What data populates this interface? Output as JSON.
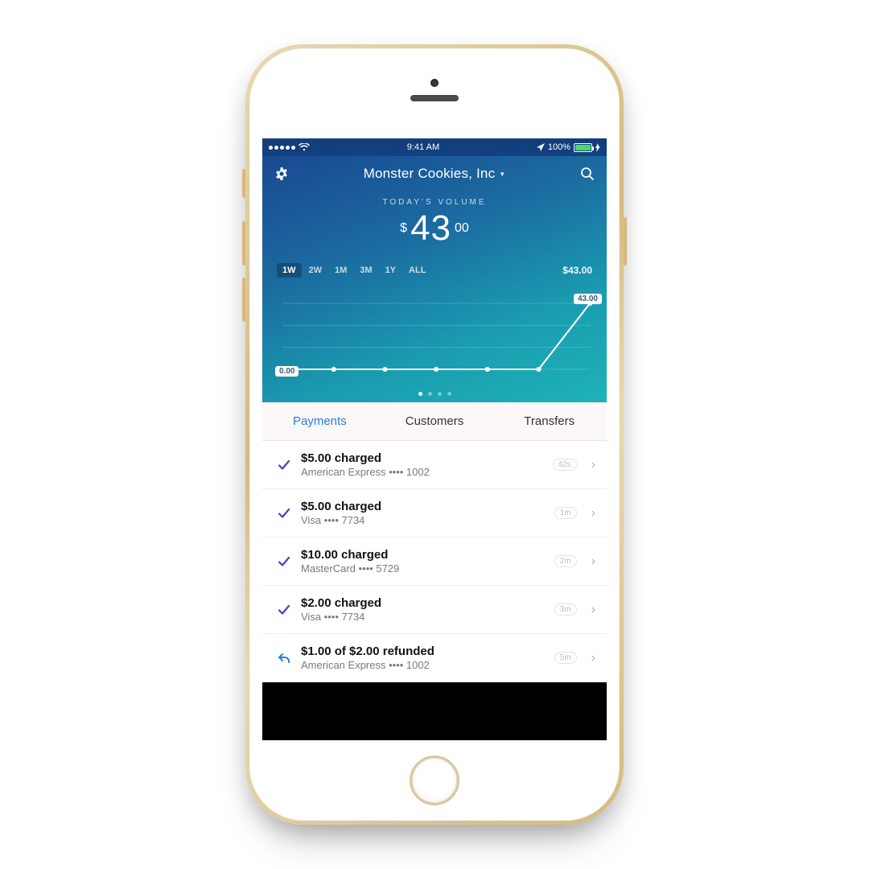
{
  "status": {
    "time": "9:41 AM",
    "battery_pct": "100%"
  },
  "header": {
    "account_name": "Monster Cookies, Inc",
    "volume_label": "TODAY'S VOLUME",
    "currency": "$",
    "volume_whole": "43",
    "volume_cents": "00"
  },
  "ranges": {
    "items": [
      "1W",
      "2W",
      "1M",
      "3M",
      "1Y",
      "ALL"
    ],
    "active_index": 0,
    "total": "$43.00"
  },
  "chart_data": {
    "type": "line",
    "title": "Volume over 1W",
    "xlabel": "",
    "ylabel": "",
    "ylim": [
      0,
      43
    ],
    "x": [
      1,
      2,
      3,
      4,
      5,
      6,
      7
    ],
    "values": [
      0,
      0,
      0,
      0,
      0,
      0,
      43
    ],
    "left_label": "0.00",
    "right_label": "43.00"
  },
  "pager": {
    "count": 4,
    "active": 0
  },
  "tabs": {
    "items": [
      "Payments",
      "Customers",
      "Transfers"
    ],
    "active_index": 0
  },
  "payments": [
    {
      "kind": "charge",
      "title": "$5.00 charged",
      "sub": "American Express •••• 1002",
      "time": "42s"
    },
    {
      "kind": "charge",
      "title": "$5.00 charged",
      "sub": "Visa •••• 7734",
      "time": "1m"
    },
    {
      "kind": "charge",
      "title": "$10.00 charged",
      "sub": "MasterCard •••• 5729",
      "time": "2m"
    },
    {
      "kind": "charge",
      "title": "$2.00 charged",
      "sub": "Visa •••• 7734",
      "time": "3m"
    },
    {
      "kind": "refund",
      "title": "$1.00 of $2.00 refunded",
      "sub": "American Express •••• 1002",
      "time": "5m"
    }
  ]
}
